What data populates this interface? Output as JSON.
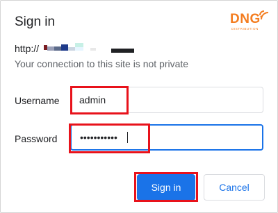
{
  "dialog": {
    "title": "Sign in",
    "url_prefix": "http://",
    "subtitle": "Your connection to this site is not private",
    "logo": {
      "text": "DNG",
      "subtext": "DISTRIBUTION",
      "color": "#f47d20"
    }
  },
  "form": {
    "username_label": "Username",
    "username_value": "admin",
    "password_label": "Password",
    "password_value": "•••••••••••"
  },
  "buttons": {
    "sign_in": "Sign in",
    "cancel": "Cancel"
  },
  "colors": {
    "accent": "#1a73e8",
    "annotation": "#e8121b"
  }
}
